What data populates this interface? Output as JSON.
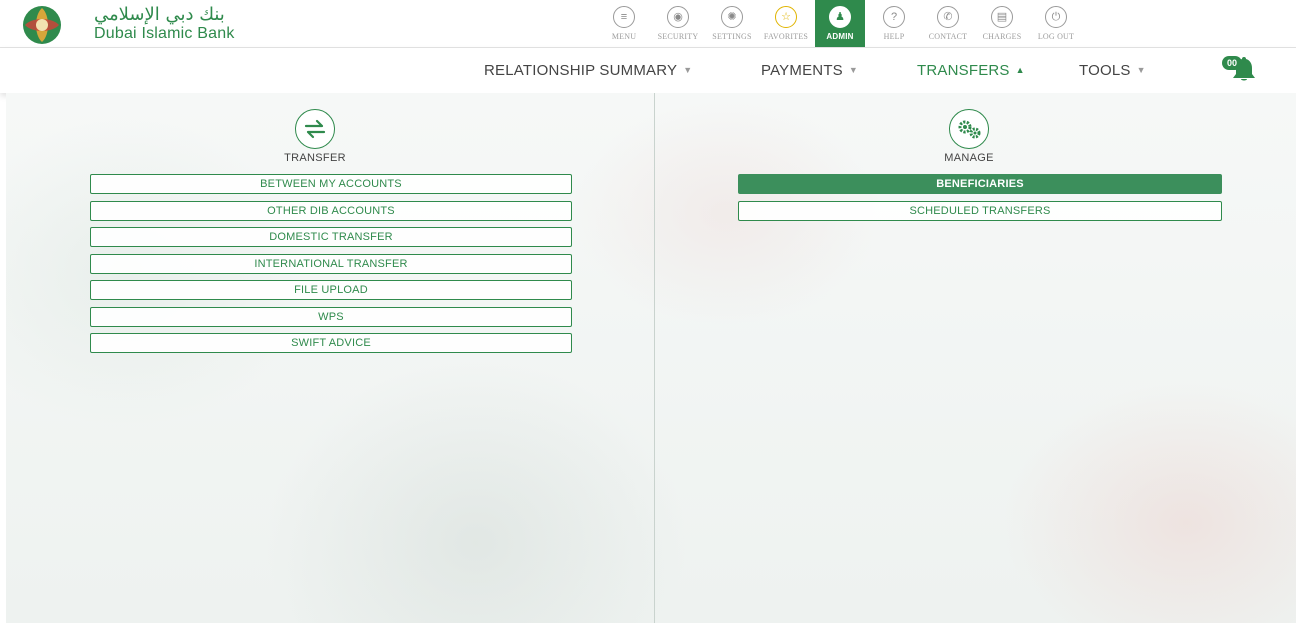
{
  "brand": {
    "name_ar": "بنك دبي الإسلامي",
    "name_en": "Dubai Islamic Bank",
    "color": "#2f8a4c"
  },
  "toolbar": {
    "items": [
      {
        "label": "MENU",
        "icon": "menu-icon",
        "glyph": "≡"
      },
      {
        "label": "SECURITY",
        "icon": "security-icon",
        "glyph": "◉"
      },
      {
        "label": "SETTINGS",
        "icon": "gear-icon",
        "glyph": "✺"
      },
      {
        "label": "FAVORITES",
        "icon": "star-icon",
        "glyph": "☆"
      },
      {
        "label": "ADMIN",
        "icon": "admin-icon",
        "glyph": "♟"
      },
      {
        "label": "HELP",
        "icon": "help-icon",
        "glyph": "?"
      },
      {
        "label": "CONTACT",
        "icon": "phone-icon",
        "glyph": "✆"
      },
      {
        "label": "CHARGES",
        "icon": "charges-icon",
        "glyph": "▤"
      },
      {
        "label": "LOG OUT",
        "icon": "power-icon",
        "glyph": "⏻"
      }
    ],
    "active": "ADMIN"
  },
  "nav": {
    "items": [
      {
        "label": "RELATIONSHIP SUMMARY",
        "caret": "▼"
      },
      {
        "label": "PAYMENTS",
        "caret": "▼"
      },
      {
        "label": "TRANSFERS",
        "caret": "▲"
      },
      {
        "label": "TOOLS",
        "caret": "▼"
      }
    ],
    "active": "TRANSFERS",
    "notification_count": "00"
  },
  "transfer": {
    "title": "TRANSFER",
    "icon": "transfer-arrows-icon",
    "buttons": [
      "BETWEEN MY ACCOUNTS",
      "OTHER DIB ACCOUNTS",
      "DOMESTIC TRANSFER",
      "INTERNATIONAL TRANSFER",
      "FILE UPLOAD",
      "WPS",
      "SWIFT ADVICE"
    ]
  },
  "manage": {
    "title": "MANAGE",
    "icon": "gears-icon",
    "buttons": [
      "BENEFICIARIES",
      "SCHEDULED TRANSFERS"
    ],
    "selected": "BENEFICIARIES"
  }
}
